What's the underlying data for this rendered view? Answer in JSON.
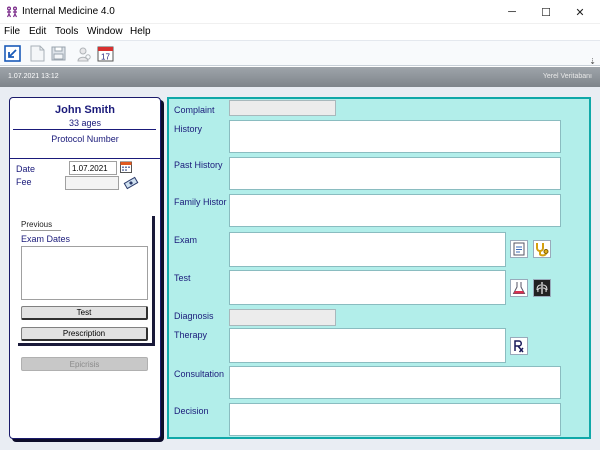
{
  "window": {
    "title": "Internal Medicine 4.0",
    "controls": {
      "minimize": "─",
      "maximize": "☐",
      "close": "✕"
    }
  },
  "menu": [
    "File",
    "Edit",
    "Tools",
    "Window",
    "Help"
  ],
  "toolbar": {
    "icons": [
      "exit-icon",
      "new-document-icon",
      "save-icon",
      "patient-search-icon",
      "calendar-17-icon"
    ],
    "calendar_day": "17",
    "overflow": "⇣"
  },
  "status": {
    "datetime": "1.07.2021 13:12",
    "db_label": "Yerel Veritabanı"
  },
  "patient": {
    "name": "John Smith",
    "age": "33 ages",
    "protocol_label": "Protocol Number",
    "date_label": "Date",
    "date_value": "1.07.2021",
    "fee_label": "Fee",
    "fee_value": ""
  },
  "previous": {
    "title": "Previous",
    "exam_dates_label": "Exam Dates",
    "test_button": "Test",
    "prescription_button": "Prescription"
  },
  "epicrisis_button": "Epicrisis",
  "form": {
    "complaint": "Complaint",
    "history": "History",
    "past_history": "Past History",
    "family_history": "Family Histor",
    "exam": "Exam",
    "test": "Test",
    "diagnosis": "Diagnosis",
    "therapy": "Therapy",
    "consultation": "Consultation",
    "decision": "Decision"
  },
  "colors": {
    "form_bg": "#b2eeea",
    "form_border": "#10a8a8",
    "label_text": "#1a1a7a",
    "status_bar": "#8e949a"
  }
}
